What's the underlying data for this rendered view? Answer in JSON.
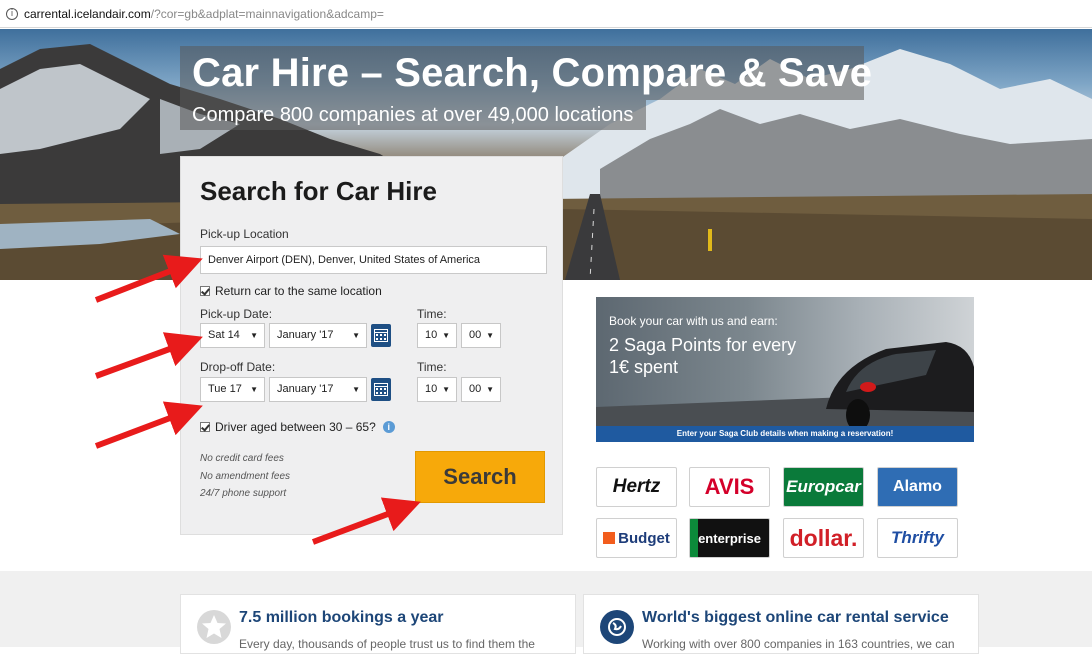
{
  "browser": {
    "url_host": "carrental.icelandair.com",
    "url_path": "/?cor=gb&adplat=mainnavigation&adcamp="
  },
  "hero": {
    "title": "Car Hire – Search, Compare & Save",
    "subtitle": "Compare 800 companies at over 49,000 locations"
  },
  "search": {
    "heading": "Search for Car Hire",
    "pickup_location_label": "Pick-up Location",
    "pickup_location_value": "Denver Airport (DEN), Denver, United States of America",
    "same_location_label": "Return car to the same location",
    "same_location_checked": true,
    "pickup_date_label": "Pick-up Date:",
    "pickup_day": "Sat 14",
    "pickup_month": "January '17",
    "pickup_time_label": "Time:",
    "pickup_hour": "10",
    "pickup_minute": "00",
    "dropoff_date_label": "Drop-off Date:",
    "dropoff_day": "Tue 17",
    "dropoff_month": "January '17",
    "dropoff_time_label": "Time:",
    "dropoff_hour": "10",
    "dropoff_minute": "00",
    "driver_age_label": "Driver aged between 30 – 65?",
    "driver_age_checked": true,
    "notes": [
      "No credit card fees",
      "No amendment fees",
      "24/7 phone support"
    ],
    "search_button": "Search"
  },
  "promo": {
    "line1": "Book your car with us and earn:",
    "line2": "2 Saga Points for every",
    "line3": "1€ spent",
    "footer": "Enter your Saga Club details when making a reservation!"
  },
  "partners": [
    "Hertz",
    "AVIS",
    "Europcar",
    "Alamo",
    "Budget",
    "enterprise",
    "dollar.",
    "Thrifty"
  ],
  "features": [
    {
      "title": "7.5 million bookings a year",
      "text": "Every day, thousands of people trust us to find them the",
      "icon": "star-icon"
    },
    {
      "title": "World's biggest online car rental service",
      "text": "Working with over 800 companies in 163 countries, we can",
      "icon": "globe-icon"
    }
  ],
  "colors": {
    "search_button": "#f7a90a",
    "brand_blue": "#1e4f84",
    "annotation_arrow": "#e81b1b"
  }
}
